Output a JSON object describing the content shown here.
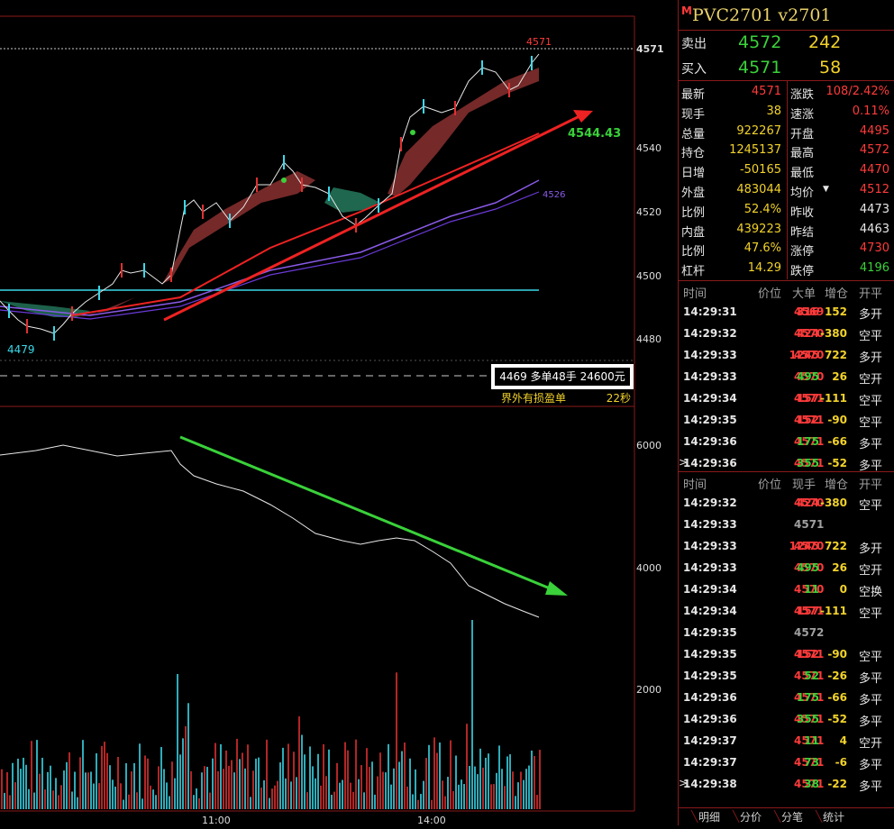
{
  "instrument": {
    "name": "PVC2701  v2701",
    "marker": "M"
  },
  "quote": {
    "ask": {
      "label": "卖出",
      "price": "4572",
      "vol": "242"
    },
    "bid": {
      "label": "买入",
      "price": "4571",
      "vol": "58"
    }
  },
  "stats": [
    {
      "l1": "最新",
      "v1": "4571",
      "c1": "red",
      "l2": "涨跌",
      "v2": "108/2.42%",
      "c2": "red"
    },
    {
      "l1": "现手",
      "v1": "38",
      "c1": "yel",
      "l2": "速涨",
      "v2": "0.11%",
      "c2": "red"
    },
    {
      "l1": "总量",
      "v1": "922267",
      "c1": "yel",
      "l2": "开盘",
      "v2": "4495",
      "c2": "red"
    },
    {
      "l1": "持仓",
      "v1": "1245137",
      "c1": "yel",
      "l2": "最高",
      "v2": "4572",
      "c2": "red"
    },
    {
      "l1": "日增",
      "v1": "-50165",
      "c1": "yel",
      "l2": "最低",
      "v2": "4470",
      "c2": "red"
    },
    {
      "l1": "外盘",
      "v1": "483044",
      "c1": "yel",
      "l2": "均价",
      "v2": "4512",
      "c2": "red"
    },
    {
      "l1": "比例",
      "v1": "52.4%",
      "c1": "yel",
      "l2": "昨收",
      "v2": "4473",
      "c2": "wht"
    },
    {
      "l1": "内盘",
      "v1": "439223",
      "c1": "yel",
      "l2": "昨结",
      "v2": "4463",
      "c2": "wht"
    },
    {
      "l1": "比例",
      "v1": "47.6%",
      "c1": "yel",
      "l2": "涨停",
      "v2": "4730",
      "c2": "red"
    },
    {
      "l1": "杠杆",
      "v1": "14.29",
      "c1": "yel",
      "l2": "跌停",
      "v2": "4196",
      "c2": "grn"
    }
  ],
  "avg_dropdown_icon": "caret-down-icon",
  "big_header": {
    "time": "时间",
    "price": "价位",
    "qty": "大单",
    "oi": "增仓",
    "type": "开平"
  },
  "big_trades": [
    {
      "time": "14:29:31",
      "price": "4569",
      "qty": "316",
      "oi": "152",
      "type": "多开",
      "qc": "red",
      "oc": "yel"
    },
    {
      "time": "14:29:32",
      "price": "4570",
      "qty": "424",
      "oi": "-380",
      "type": "空平",
      "qc": "red",
      "oc": "yel"
    },
    {
      "time": "14:29:33",
      "price": "4570",
      "qty": "1245",
      "oi": "722",
      "type": "多开",
      "qc": "red",
      "oc": "yel"
    },
    {
      "time": "14:29:33",
      "price": "4570",
      "qty": "495",
      "oi": "26",
      "type": "空开",
      "qc": "grn",
      "oc": "yel"
    },
    {
      "time": "14:29:34",
      "price": "4571",
      "qty": "157",
      "oi": "-111",
      "type": "空平",
      "qc": "red",
      "oc": "yel"
    },
    {
      "time": "14:29:35",
      "price": "4571",
      "qty": "152",
      "oi": "-90",
      "type": "空平",
      "qc": "red",
      "oc": "yel"
    },
    {
      "time": "14:29:36",
      "price": "4571",
      "qty": "175",
      "oi": "-66",
      "type": "多平",
      "qc": "grn",
      "oc": "yel"
    },
    {
      "time": "14:29:36",
      "price": "4571",
      "qty": "355",
      "oi": "-52",
      "type": "多平",
      "qc": "grn",
      "oc": "yel",
      "mark": ">"
    }
  ],
  "tick_header": {
    "time": "时间",
    "price": "价位",
    "qty": "现手",
    "oi": "增仓",
    "type": "开平"
  },
  "ticks": [
    {
      "time": "14:29:32",
      "price": "4570",
      "qty": "424",
      "oi": "-380",
      "type": "空平",
      "qc": "red",
      "pc": "red"
    },
    {
      "time": "14:29:33",
      "price": "4571",
      "qty": "",
      "oi": "",
      "type": "",
      "qc": "red",
      "pc": "gry"
    },
    {
      "time": "14:29:33",
      "price": "4570",
      "qty": "1245",
      "oi": "722",
      "type": "多开",
      "qc": "red",
      "pc": "red"
    },
    {
      "time": "14:29:33",
      "price": "4570",
      "qty": "495",
      "oi": "26",
      "type": "空开",
      "qc": "grn",
      "pc": "red"
    },
    {
      "time": "14:29:34",
      "price": "4570",
      "qty": "11",
      "oi": "0",
      "type": "空换",
      "qc": "grn",
      "pc": "red"
    },
    {
      "time": "14:29:34",
      "price": "4571",
      "qty": "157",
      "oi": "-111",
      "type": "空平",
      "qc": "red",
      "pc": "red"
    },
    {
      "time": "14:29:35",
      "price": "4572",
      "qty": "",
      "oi": "",
      "type": "",
      "qc": "red",
      "pc": "gry"
    },
    {
      "time": "14:29:35",
      "price": "4571",
      "qty": "152",
      "oi": "-90",
      "type": "空平",
      "qc": "red",
      "pc": "red"
    },
    {
      "time": "14:29:35",
      "price": "4571",
      "qty": "52",
      "oi": "-26",
      "type": "多平",
      "qc": "grn",
      "pc": "red"
    },
    {
      "time": "14:29:36",
      "price": "4571",
      "qty": "175",
      "oi": "-66",
      "type": "多平",
      "qc": "grn",
      "pc": "red"
    },
    {
      "time": "14:29:36",
      "price": "4571",
      "qty": "355",
      "oi": "-52",
      "type": "多平",
      "qc": "grn",
      "pc": "red"
    },
    {
      "time": "14:29:37",
      "price": "4571",
      "qty": "11",
      "oi": "4",
      "type": "空开",
      "qc": "grn",
      "pc": "red"
    },
    {
      "time": "14:29:37",
      "price": "4571",
      "qty": "73",
      "oi": "-6",
      "type": "多平",
      "qc": "grn",
      "pc": "red"
    },
    {
      "time": "14:29:38",
      "price": "4571",
      "qty": "38",
      "oi": "-22",
      "type": "多平",
      "qc": "grn",
      "pc": "red",
      "mark": ">"
    }
  ],
  "tabs": [
    "明细",
    "分价",
    "分笔",
    "统计"
  ],
  "chart_data": {
    "type": "line",
    "price_axis": [
      "4571",
      "4540",
      "4520",
      "4500",
      "4480"
    ],
    "oi_axis": [
      "6000",
      "4000",
      "2000"
    ],
    "time_axis": [
      "11:00",
      "14:00"
    ],
    "labels": {
      "high": "4571",
      "low": "4479",
      "target": "4544.43",
      "ma": "4526",
      "order_box": "4469 多单48手 24600元",
      "order_note": "界外有损盈单",
      "timer": "22秒"
    }
  }
}
